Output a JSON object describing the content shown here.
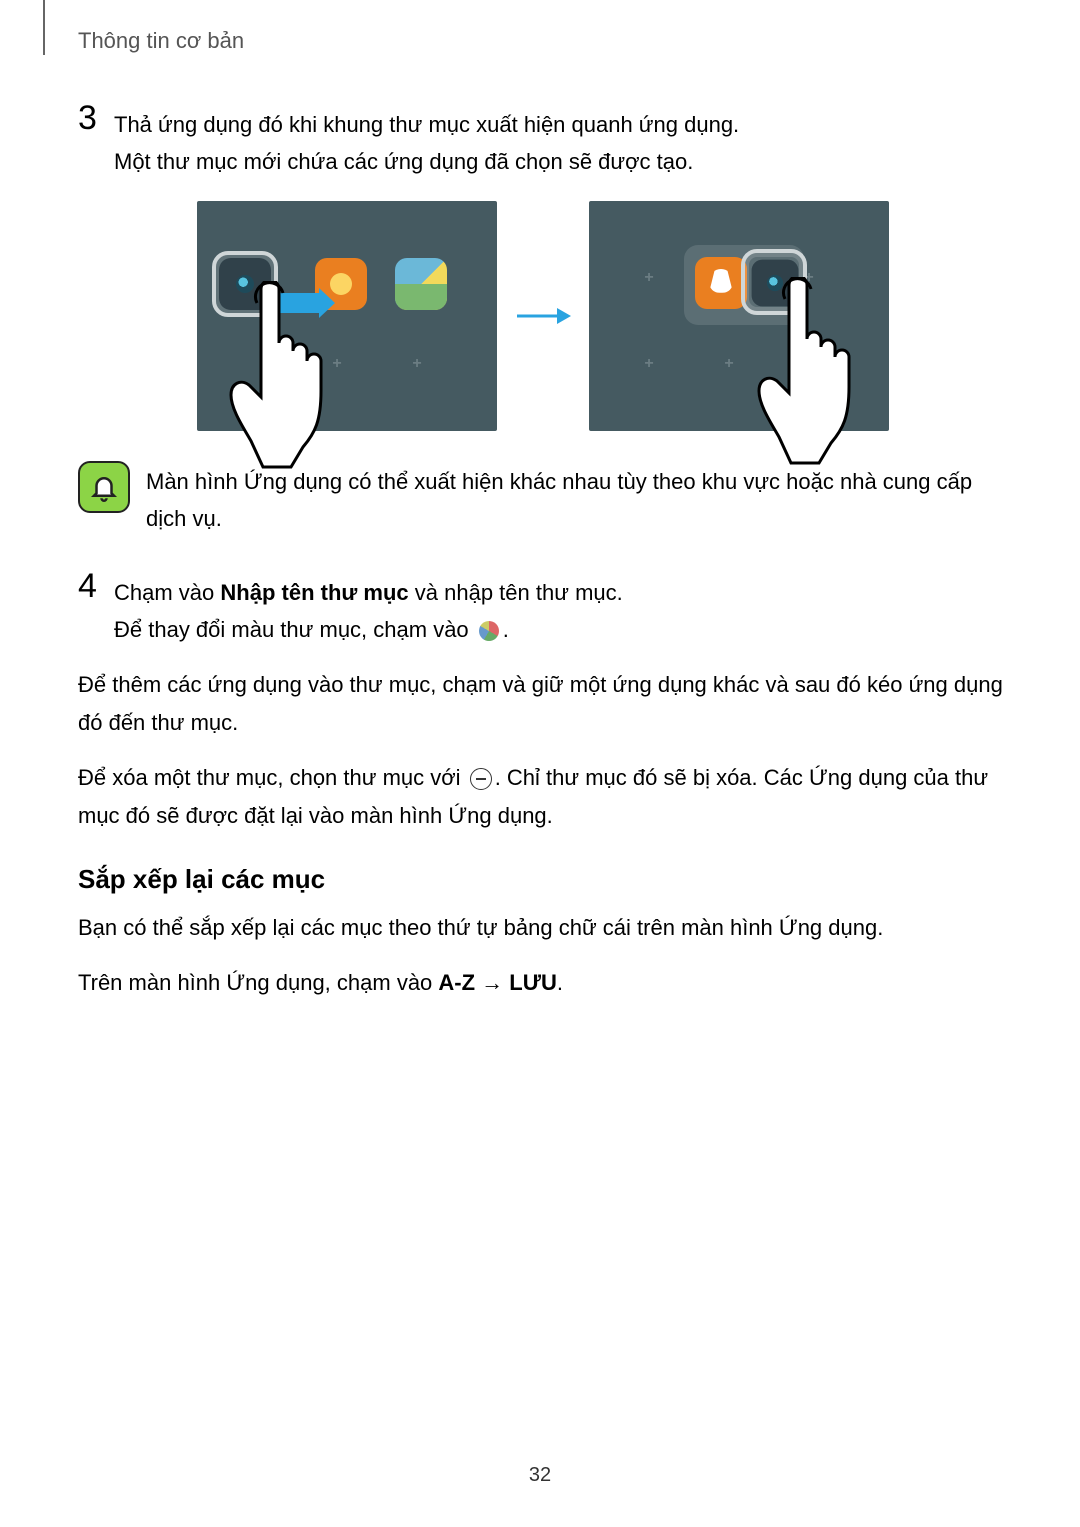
{
  "header": {
    "title": "Thông tin cơ bản"
  },
  "step3": {
    "num": "3",
    "line1": "Thả ứng dụng đó khi khung thư mục xuất hiện quanh ứng dụng.",
    "line2": "Một thư mục mới chứa các ứng dụng đã chọn sẽ được tạo."
  },
  "note": "Màn hình Ứng dụng có thể xuất hiện khác nhau tùy theo khu vực hoặc nhà cung cấp dịch vụ.",
  "step4": {
    "num": "4",
    "line1a": "Chạm vào ",
    "line1b": "Nhập tên thư mục",
    "line1c": " và nhập tên thư mục.",
    "line2a": "Để thay đổi màu thư mục, chạm vào ",
    "line2b": "."
  },
  "para1": "Để thêm các ứng dụng vào thư mục, chạm và giữ một ứng dụng khác và sau đó kéo ứng dụng đó đến thư mục.",
  "para2a": "Để xóa một thư mục, chọn thư mục với ",
  "para2b": ". Chỉ thư mục đó sẽ bị xóa. Các Ứng dụng của thư mục đó sẽ được đặt lại vào màn hình Ứng dụng.",
  "subhead": "Sắp xếp lại các mục",
  "sub_p1": "Bạn có thể sắp xếp lại các mục theo thứ tự bảng chữ cái trên màn hình Ứng dụng.",
  "sub_p2a": "Trên màn hình Ứng dụng, chạm vào ",
  "sub_p2b": "A-Z",
  "sub_p2c": " → ",
  "sub_p2d": "LƯU",
  "sub_p2e": ".",
  "page_number": "32"
}
